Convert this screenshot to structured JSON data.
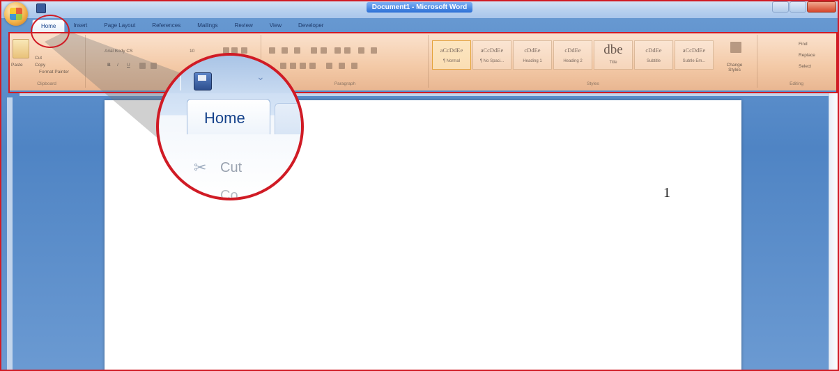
{
  "window": {
    "title": "Document1 - Microsoft Word"
  },
  "tabs": [
    {
      "label": "Home",
      "active": true
    },
    {
      "label": "Insert"
    },
    {
      "label": "Page Layout"
    },
    {
      "label": "References"
    },
    {
      "label": "Mailings"
    },
    {
      "label": "Review"
    },
    {
      "label": "View"
    },
    {
      "label": "Developer"
    }
  ],
  "ribbon": {
    "clipboard": {
      "paste": "Paste",
      "cut": "Cut",
      "copy": "Copy",
      "format_painter": "Format Painter",
      "group_label": "Clipboard"
    },
    "font": {
      "font_name": "Arial Body CS",
      "font_size": "10",
      "bold": "B",
      "italic": "I",
      "underline": "U"
    },
    "paragraph": {
      "group_label": "Paragraph"
    },
    "styles": {
      "items": [
        {
          "sample": "aCcDdEe",
          "name": "¶ Normal"
        },
        {
          "sample": "aCcDdEe",
          "name": "¶ No Spaci..."
        },
        {
          "sample": "cDdEe",
          "name": "Heading 1"
        },
        {
          "sample": "cDdEe",
          "name": "Heading 2"
        },
        {
          "sample": "dbe",
          "name": "Title"
        },
        {
          "sample": "cDdEe",
          "name": "Subtitle"
        },
        {
          "sample": "aCcDdEe",
          "name": "Subtle Em..."
        }
      ],
      "change_styles": "Change Styles",
      "group_label": "Styles"
    },
    "editing": {
      "find": "Find",
      "replace": "Replace",
      "select": "Select",
      "group_label": "Editing"
    }
  },
  "document": {
    "page_number": "1"
  },
  "magnifier": {
    "tab_label": "Home",
    "cut_label": "Cut",
    "copy_label": "Co"
  },
  "colors": {
    "annotation_red": "#d01b25",
    "ribbon_peach": "#f3c9a6",
    "tab_blue": "#15428b"
  }
}
